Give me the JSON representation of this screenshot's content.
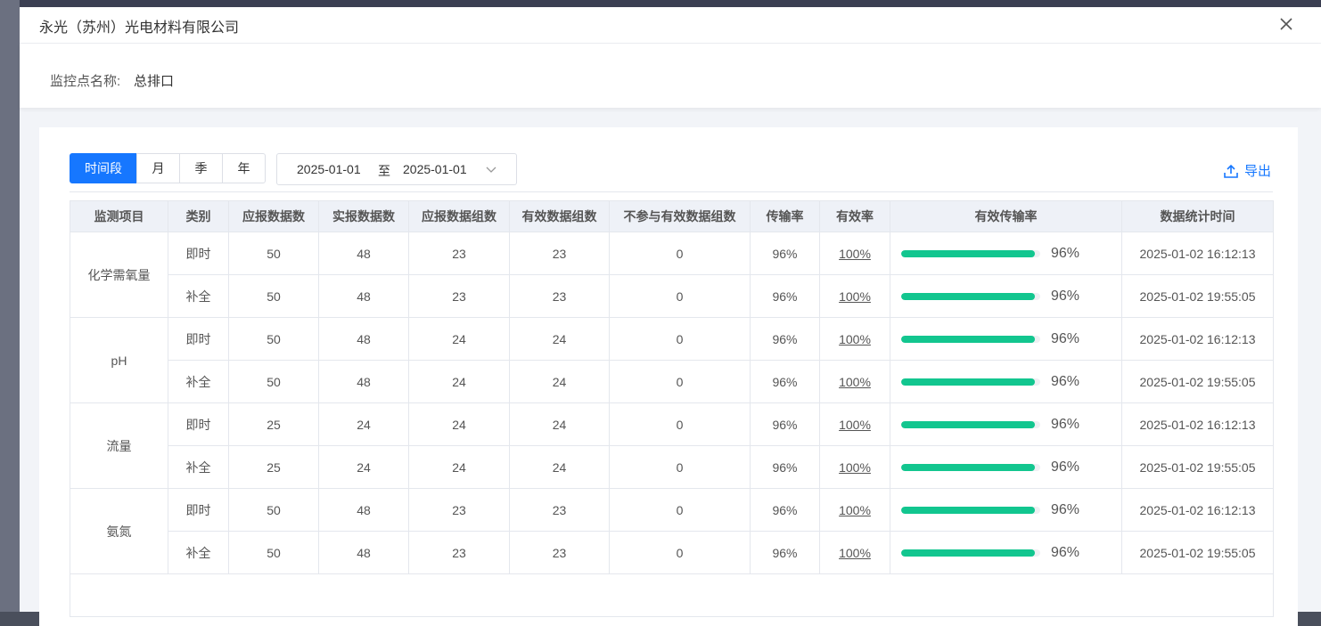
{
  "dialog": {
    "title": "永光（苏州）光电材料有限公司",
    "close_icon": "close-icon"
  },
  "info": {
    "label": "监控点名称:",
    "value": "总排口"
  },
  "toolbar": {
    "tabs": [
      "时间段",
      "月",
      "季",
      "年"
    ],
    "active_tab": 0,
    "date_start": "2025-01-01",
    "date_sep": "至",
    "date_end": "2025-01-01",
    "export_label": "导出"
  },
  "colors": {
    "accent": "#1677ff",
    "bar": "#12c68f"
  },
  "table": {
    "headers": [
      "监测项目",
      "类别",
      "应报数据数",
      "实报数据数",
      "应报数据组数",
      "有效数据组数",
      "不参与有效数据组数",
      "传输率",
      "有效率",
      "有效传输率",
      "数据统计时间"
    ],
    "groups": [
      {
        "item": "化学需氧量",
        "rows": [
          {
            "type": "即时",
            "should": "50",
            "actual": "48",
            "should_groups": "23",
            "valid_groups": "23",
            "excluded": "0",
            "trans_rate": "96%",
            "valid_rate": "100%",
            "eff_rate": 0.96,
            "eff_rate_label": "96%",
            "time": "2025-01-02 16:12:13"
          },
          {
            "type": "补全",
            "should": "50",
            "actual": "48",
            "should_groups": "23",
            "valid_groups": "23",
            "excluded": "0",
            "trans_rate": "96%",
            "valid_rate": "100%",
            "eff_rate": 0.96,
            "eff_rate_label": "96%",
            "time": "2025-01-02 19:55:05"
          }
        ]
      },
      {
        "item": "pH",
        "rows": [
          {
            "type": "即时",
            "should": "50",
            "actual": "48",
            "should_groups": "24",
            "valid_groups": "24",
            "excluded": "0",
            "trans_rate": "96%",
            "valid_rate": "100%",
            "eff_rate": 0.96,
            "eff_rate_label": "96%",
            "time": "2025-01-02 16:12:13"
          },
          {
            "type": "补全",
            "should": "50",
            "actual": "48",
            "should_groups": "24",
            "valid_groups": "24",
            "excluded": "0",
            "trans_rate": "96%",
            "valid_rate": "100%",
            "eff_rate": 0.96,
            "eff_rate_label": "96%",
            "time": "2025-01-02 19:55:05"
          }
        ]
      },
      {
        "item": "流量",
        "rows": [
          {
            "type": "即时",
            "should": "25",
            "actual": "24",
            "should_groups": "24",
            "valid_groups": "24",
            "excluded": "0",
            "trans_rate": "96%",
            "valid_rate": "100%",
            "eff_rate": 0.96,
            "eff_rate_label": "96%",
            "time": "2025-01-02 16:12:13"
          },
          {
            "type": "补全",
            "should": "25",
            "actual": "24",
            "should_groups": "24",
            "valid_groups": "24",
            "excluded": "0",
            "trans_rate": "96%",
            "valid_rate": "100%",
            "eff_rate": 0.96,
            "eff_rate_label": "96%",
            "time": "2025-01-02 19:55:05"
          }
        ]
      },
      {
        "item": "氨氮",
        "rows": [
          {
            "type": "即时",
            "should": "50",
            "actual": "48",
            "should_groups": "23",
            "valid_groups": "23",
            "excluded": "0",
            "trans_rate": "96%",
            "valid_rate": "100%",
            "eff_rate": 0.96,
            "eff_rate_label": "96%",
            "time": "2025-01-02 16:12:13"
          },
          {
            "type": "补全",
            "should": "50",
            "actual": "48",
            "should_groups": "23",
            "valid_groups": "23",
            "excluded": "0",
            "trans_rate": "96%",
            "valid_rate": "100%",
            "eff_rate": 0.96,
            "eff_rate_label": "96%",
            "time": "2025-01-02 19:55:05"
          }
        ]
      }
    ]
  }
}
